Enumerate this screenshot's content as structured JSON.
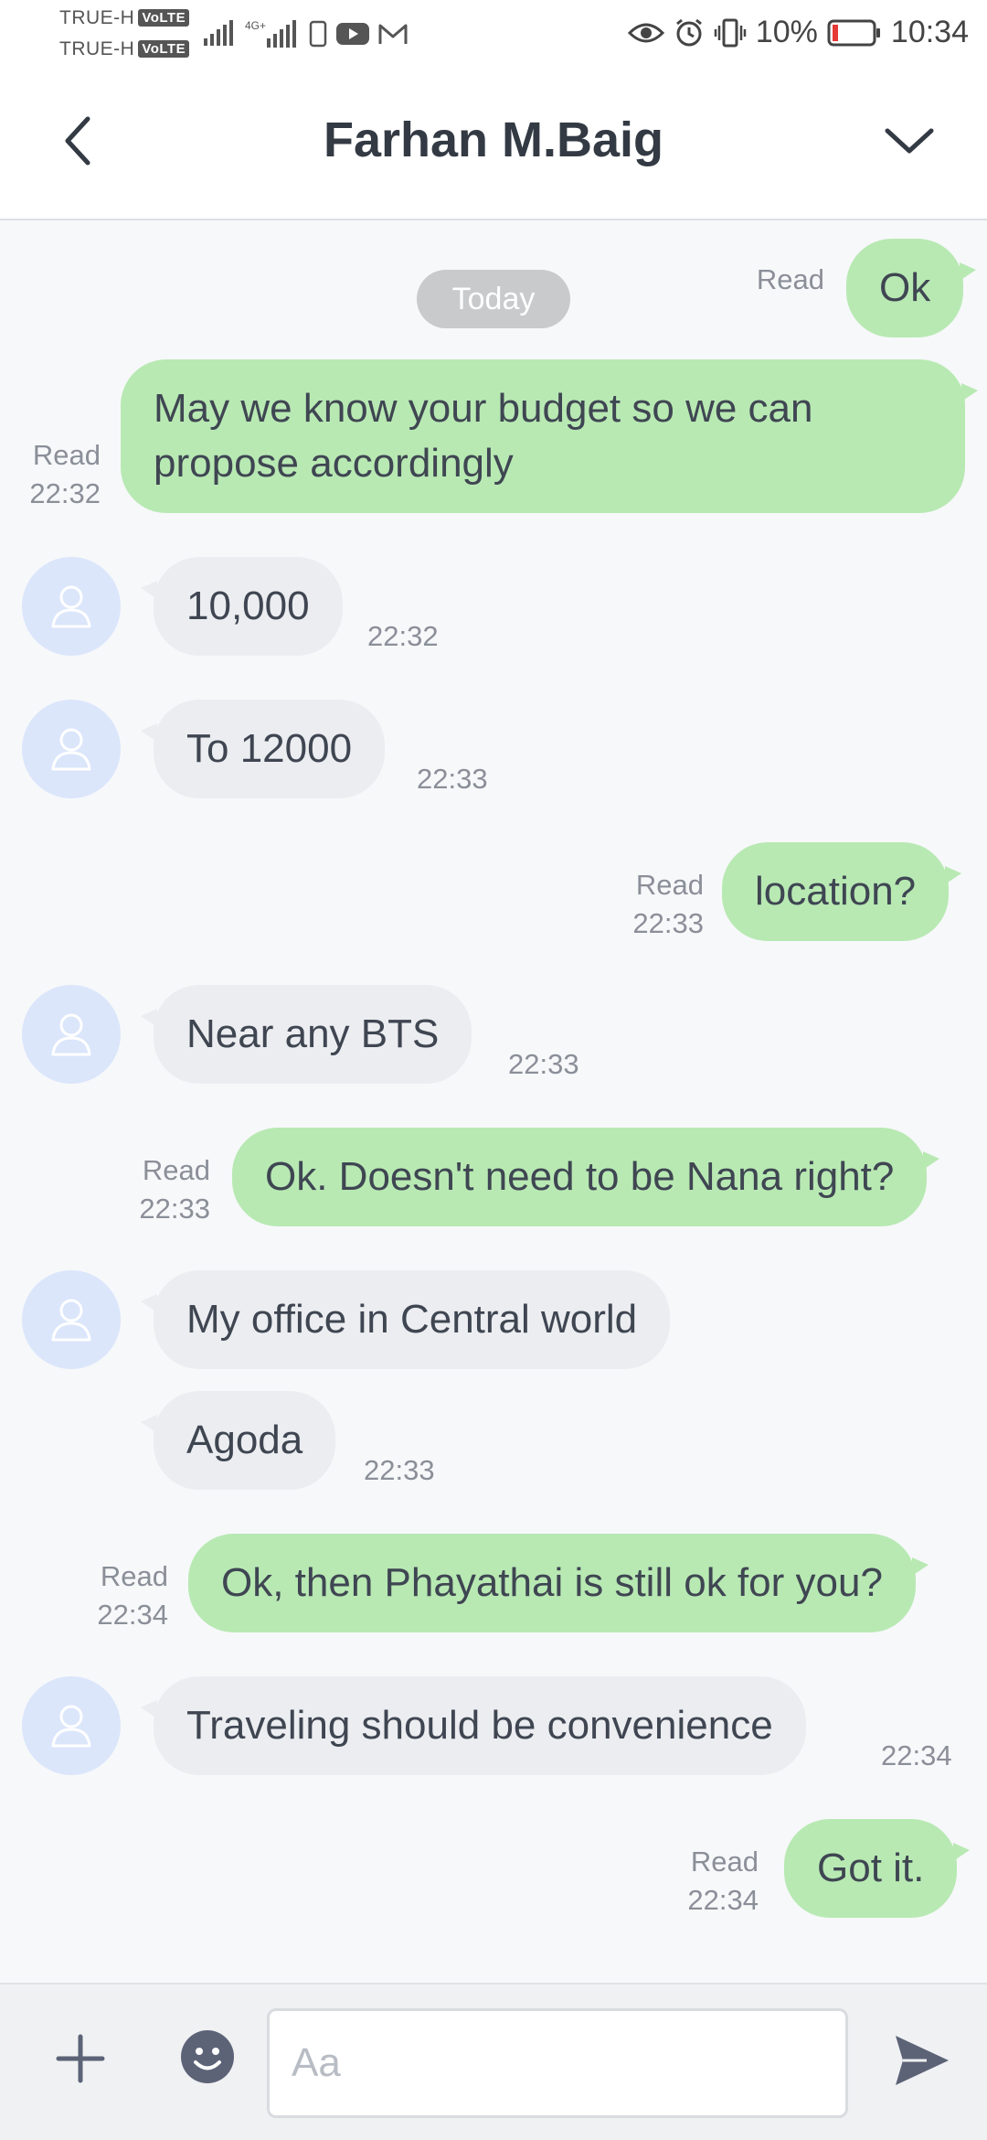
{
  "status_bar": {
    "carrier1": "TRUE-H",
    "carrier2": "TRUE-H",
    "volte": "VoLTE",
    "network": "4G+",
    "battery": "10%",
    "time": "10:34"
  },
  "header": {
    "title": "Farhan M.Baig"
  },
  "chat": {
    "date_label": "Today",
    "messages": [
      {
        "dir": "out",
        "text": "Ok",
        "read": "Read",
        "time": ""
      },
      {
        "dir": "out",
        "text": "May we know your budget so we can propose accordingly",
        "read": "Read",
        "time": "22:32"
      },
      {
        "dir": "in",
        "text": "10,000",
        "time": "22:32"
      },
      {
        "dir": "in",
        "text": "To 12000",
        "time": "22:33"
      },
      {
        "dir": "out",
        "text": "location?",
        "read": "Read",
        "time": "22:33"
      },
      {
        "dir": "in",
        "text": "Near any BTS",
        "time": "22:33"
      },
      {
        "dir": "out",
        "text": "Ok. Doesn't need to be Nana right?",
        "read": "Read",
        "time": "22:33"
      },
      {
        "dir": "in",
        "text": "My office in Central world",
        "time": ""
      },
      {
        "dir": "in",
        "text": "Agoda",
        "time": "22:33"
      },
      {
        "dir": "out",
        "text": "Ok, then Phayathai is still ok for you?",
        "read": "Read",
        "time": "22:34"
      },
      {
        "dir": "in",
        "text": "Traveling should be convenience",
        "time": "22:34"
      },
      {
        "dir": "out",
        "text": "Got it.",
        "read": "Read",
        "time": "22:34"
      }
    ]
  },
  "input": {
    "placeholder": "Aa",
    "value": ""
  },
  "icons": {
    "back": "chevron-left-icon",
    "expand": "chevron-down-icon",
    "plus": "plus-icon",
    "emoji": "emoji-icon",
    "send": "send-icon",
    "avatar": "user-icon"
  },
  "colors": {
    "outgoing_bubble": "#b8e9b3",
    "incoming_bubble": "#ebedf0",
    "avatar_bg": "#dbe6fb"
  }
}
